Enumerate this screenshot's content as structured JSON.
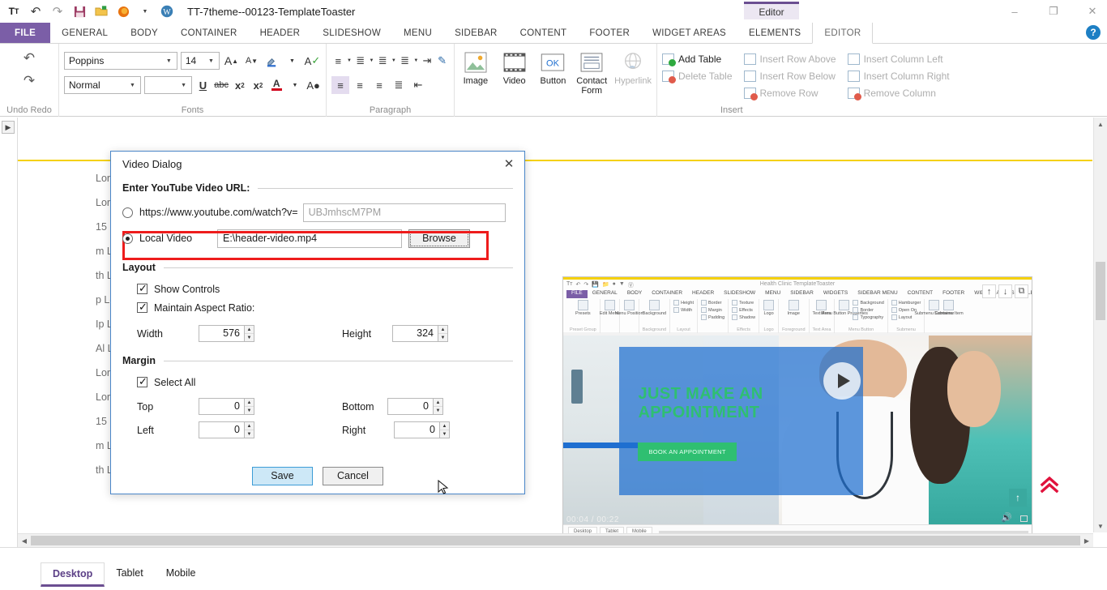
{
  "titlebar": {
    "app_title": "TT-7theme--00123-TemplateToaster",
    "quick_access": [
      {
        "name": "text-format-icon",
        "glyph": "Tᴛ"
      },
      {
        "name": "undo-icon",
        "glyph": "↶"
      },
      {
        "name": "redo-icon",
        "glyph": "↷"
      },
      {
        "name": "save-icon",
        "glyph": "Ὃe"
      },
      {
        "name": "open-folder-icon",
        "glyph": "Ὄ2"
      },
      {
        "name": "firefox-preview-icon",
        "glyph": "●"
      },
      {
        "name": "dropdown-icon",
        "glyph": "▾"
      },
      {
        "name": "wordpress-icon",
        "glyph": "W"
      }
    ],
    "context_tab": "Editor",
    "window_buttons": [
      {
        "name": "minimize-button",
        "glyph": "–"
      },
      {
        "name": "restore-button",
        "glyph": "❐"
      },
      {
        "name": "close-button",
        "glyph": "✕"
      }
    ],
    "help_label": "?"
  },
  "ribbon_tabs": [
    "FILE",
    "GENERAL",
    "BODY",
    "CONTAINER",
    "HEADER",
    "SLIDESHOW",
    "MENU",
    "SIDEBAR",
    "CONTENT",
    "FOOTER",
    "WIDGET AREAS",
    "ELEMENTS",
    "EDITOR"
  ],
  "ribbon": {
    "undo_redo": {
      "label": "Undo Redo",
      "undo": "↶",
      "redo": "↷"
    },
    "fonts": {
      "label": "Fonts",
      "font_family": "Poppins",
      "font_size": "14",
      "style": "Normal",
      "secondary": "",
      "buttons": [
        {
          "name": "grow-font-button",
          "glyph": "A"
        },
        {
          "name": "shrink-font-button",
          "glyph": "A"
        },
        {
          "name": "highlight-color-button",
          "glyph": "✐"
        },
        {
          "name": "clear-formatting-button",
          "glyph": "A"
        },
        {
          "name": "underline-button",
          "glyph": "U"
        },
        {
          "name": "strikethrough-button",
          "glyph": "abc"
        },
        {
          "name": "subscript-button",
          "glyph": "x"
        },
        {
          "name": "superscript-button",
          "glyph": "x"
        },
        {
          "name": "font-color-button",
          "glyph": "A"
        },
        {
          "name": "text-effects-button",
          "glyph": "A"
        }
      ]
    },
    "paragraph": {
      "label": "Paragraph",
      "buttons": [
        {
          "name": "bullet-list-button",
          "glyph": "☰"
        },
        {
          "name": "numbered-list-button",
          "glyph": "≡"
        },
        {
          "name": "multilevel-list-button",
          "glyph": "≣"
        },
        {
          "name": "line-spacing-button",
          "glyph": "↕"
        },
        {
          "name": "increase-indent-button",
          "glyph": "⇥"
        },
        {
          "name": "format-painter-button",
          "glyph": "✐"
        },
        {
          "name": "align-left-button",
          "glyph": "☰"
        },
        {
          "name": "align-center-button",
          "glyph": "☰"
        },
        {
          "name": "align-right-button",
          "glyph": "☰"
        },
        {
          "name": "justify-button",
          "glyph": "☰"
        },
        {
          "name": "decrease-indent-button",
          "glyph": "⇤"
        }
      ]
    },
    "insert_elements": [
      {
        "name": "insert-image-button",
        "label": "Image",
        "disabled": false
      },
      {
        "name": "insert-video-button",
        "label": "Video",
        "disabled": false
      },
      {
        "name": "insert-button-button",
        "label": "Button",
        "disabled": false
      },
      {
        "name": "insert-contact-form-button",
        "label": "Contact Form",
        "disabled": false
      },
      {
        "name": "insert-hyperlink-button",
        "label": "Hyperlink",
        "disabled": true
      }
    ],
    "insert": {
      "label": "Insert",
      "commands": [
        {
          "name": "add-table-command",
          "label": "Add Table",
          "disabled": false,
          "mark": "green"
        },
        {
          "name": "delete-table-command",
          "label": "Delete Table",
          "disabled": true,
          "mark": "red"
        },
        {
          "name": "insert-row-above-command",
          "label": "Insert Row Above",
          "disabled": true,
          "mark": "none"
        },
        {
          "name": "insert-row-below-command",
          "label": "Insert Row Below",
          "disabled": true,
          "mark": "none"
        },
        {
          "name": "remove-row-command",
          "label": "Remove Row",
          "disabled": true,
          "mark": "red"
        },
        {
          "name": "insert-column-left-command",
          "label": "Insert Column Left",
          "disabled": true,
          "mark": "none"
        },
        {
          "name": "insert-column-right-command",
          "label": "Insert Column Right",
          "disabled": true,
          "mark": "none"
        },
        {
          "name": "remove-column-command",
          "label": "Remove Column",
          "disabled": true,
          "mark": "red"
        }
      ]
    }
  },
  "canvas": {
    "text_lines": [
      "Lorem ipsum dolor sit amet, consectetur adipiscing elit, sed do",
      "Lorem ipsum dolor sit amet, consectetur adipiscing elit, sed",
      "15 Lorem ipsum dolor sit amet consectetur",
      "m Lorem ipsum dolor sit amet, consectetur adipiscing",
      "th Lorem ipsum dolor sit amet consectetur adipiscing elit",
      "p Lorem ipsum dolor sit amet",
      "Ip Lorem ipsum dolor sit amet consectetur",
      "Al Lorem ipsum dolor",
      "",
      "Lorem ipsum dolor sit amet, consectetur adipiscing elit, sed do",
      "Lorem ipsum dolor sit amet, consectetur adipiscing elit, sed",
      "15 Lorem ipsum dolor sit amet consectetur",
      "m Lorem ipsum dolor sit amet, consectetur adipiscing is",
      "th Lorem ipsum dolor sit amet consectetur m"
    ]
  },
  "preview": {
    "app_title": "Health Clinic TemplateToaster",
    "tabs": [
      "FILE",
      "GENERAL",
      "BODY",
      "CONTAINER",
      "HEADER",
      "SLIDESHOW",
      "MENU",
      "SIDEBAR",
      "WIDGETS",
      "SIDEBAR MENU",
      "CONTENT",
      "FOOTER",
      "WIDGET AREAS",
      "ELEMENTS"
    ],
    "groups": [
      {
        "name": "preset-group",
        "label": "Preset Group",
        "items": [
          {
            "type": "icon",
            "label": "Presets"
          }
        ]
      },
      {
        "name": "edit-menu-group",
        "label": "",
        "items": [
          {
            "type": "icon",
            "label": "Edit Menu"
          }
        ]
      },
      {
        "name": "menu-position-group",
        "label": "",
        "items": [
          {
            "type": "icon",
            "label": "Menu Position"
          }
        ]
      },
      {
        "name": "background-group",
        "label": "Background",
        "items": [
          {
            "type": "icon",
            "label": "Background"
          }
        ]
      },
      {
        "name": "layout-group",
        "label": "Layout",
        "items": [
          {
            "type": "mini",
            "label": "Height"
          },
          {
            "type": "mini",
            "label": "Width"
          },
          {
            "type": "mini",
            "label": "Border"
          },
          {
            "type": "mini",
            "label": "Margin"
          },
          {
            "type": "mini",
            "label": "Padding"
          }
        ]
      },
      {
        "name": "effects-group",
        "label": "Effects",
        "items": [
          {
            "type": "mini",
            "label": "Texture"
          },
          {
            "type": "mini",
            "label": "Effects"
          },
          {
            "type": "mini",
            "label": "Shadow"
          }
        ]
      },
      {
        "name": "logo-group",
        "label": "Logo",
        "items": [
          {
            "type": "icon",
            "label": "Logo"
          }
        ]
      },
      {
        "name": "foreground-group",
        "label": "Foreground",
        "items": [
          {
            "type": "icon",
            "label": "Image"
          }
        ]
      },
      {
        "name": "text-area-group",
        "label": "Text Area",
        "items": [
          {
            "type": "icon",
            "label": "Text Area"
          }
        ]
      },
      {
        "name": "menu-button-group",
        "label": "Menu Button",
        "items": [
          {
            "type": "icon",
            "label": "Menu Button Properties"
          },
          {
            "type": "mini",
            "label": "Background"
          },
          {
            "type": "mini",
            "label": "Border"
          },
          {
            "type": "mini",
            "label": "Typography"
          }
        ]
      },
      {
        "name": "submenu-group",
        "label": "Submenu",
        "items": [
          {
            "type": "mini",
            "label": "Hamburger"
          },
          {
            "type": "mini",
            "label": "Open On"
          },
          {
            "type": "mini",
            "label": "Layout"
          }
        ]
      },
      {
        "name": "submenu-container-group",
        "label": "",
        "items": [
          {
            "type": "icon",
            "label": "Submenu Container"
          },
          {
            "type": "icon",
            "label": "Submenu Item"
          }
        ]
      }
    ],
    "toolbar_icons": [
      {
        "name": "move-up-icon",
        "glyph": "↑"
      },
      {
        "name": "move-down-icon",
        "glyph": "↓"
      },
      {
        "name": "duplicate-icon",
        "glyph": "⧉"
      }
    ],
    "video_overlay": {
      "heading": "JUST MAKE AN APPOINTMENT",
      "button_label": "BOOK AN APPOINTMENT",
      "time": "00:04 / 00:22"
    },
    "device_tabs": [
      "Desktop",
      "Tablet",
      "Mobile"
    ]
  },
  "dialog": {
    "title": "Video Dialog",
    "close_glyph": "✕",
    "youtube_section_label": "Enter YouTube Video URL:",
    "youtube_option_label": "https://www.youtube.com/watch?v=",
    "youtube_placeholder": "UBJmhscM7PM",
    "youtube_value": "",
    "youtube_selected": false,
    "local_option_label": "Local Video",
    "local_value": "E:\\header-video.mp4",
    "local_selected": true,
    "browse_label": "Browse",
    "layout_label": "Layout",
    "show_controls_label": "Show Controls",
    "show_controls_checked": true,
    "maintain_aspect_label": "Maintain Aspect Ratio:",
    "maintain_aspect_checked": true,
    "width_label": "Width",
    "width_value": "576",
    "height_label": "Height",
    "height_value": "324",
    "margin_label": "Margin",
    "select_all_label": "Select All",
    "select_all_checked": true,
    "top_label": "Top",
    "top_value": "0",
    "bottom_label": "Bottom",
    "bottom_value": "0",
    "left_label": "Left",
    "left_value": "0",
    "right_label": "Right",
    "right_value": "0",
    "save_label": "Save",
    "cancel_label": "Cancel",
    "highlight_color": "#ee1c1c"
  },
  "statusbar": {
    "device_tabs": [
      {
        "name": "device-tab-desktop",
        "label": "Desktop",
        "active": true
      },
      {
        "name": "device-tab-tablet",
        "label": "Tablet",
        "active": false
      },
      {
        "name": "device-tab-mobile",
        "label": "Mobile",
        "active": false
      }
    ],
    "scroll_top_glyph": "«"
  },
  "colors": {
    "accent_purple": "#7b5ea7",
    "highlight_red": "#ee1c1c",
    "overlay_blue": "#1f6fd0",
    "cta_green": "#2fbf71"
  }
}
